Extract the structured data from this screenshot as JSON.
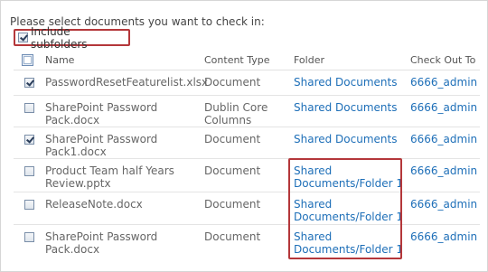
{
  "prompt": "Please select documents you want to check in:",
  "include_subfolders": {
    "label": "Include subfolders",
    "checked": true
  },
  "columns": {
    "name": "Name",
    "content_type": "Content Type",
    "folder": "Folder",
    "check_out_to": "Check Out To"
  },
  "rows": [
    {
      "checked": true,
      "name": "PasswordResetFeaturelist.xlsx",
      "type": "Document",
      "folder": "Shared Documents",
      "user": "6666_admin"
    },
    {
      "checked": false,
      "name": "SharePoint Password Pack.docx",
      "type": "Dublin Core Columns",
      "folder": "Shared Documents",
      "user": "6666_admin"
    },
    {
      "checked": true,
      "name": "SharePoint Password Pack1.docx",
      "type": "Document",
      "folder": "Shared Documents",
      "user": "6666_admin"
    },
    {
      "checked": false,
      "name": "Product Team half Years Review.pptx",
      "type": "Document",
      "folder": "Shared Documents/Folder 1",
      "user": "6666_admin"
    },
    {
      "checked": false,
      "name": "ReleaseNote.docx",
      "type": "Document",
      "folder": "Shared Documents/Folder 1",
      "user": "6666_admin"
    },
    {
      "checked": false,
      "name": "SharePoint Password Pack.docx",
      "type": "Document",
      "folder": "Shared Documents/Folder 1",
      "user": "6666_admin"
    }
  ]
}
